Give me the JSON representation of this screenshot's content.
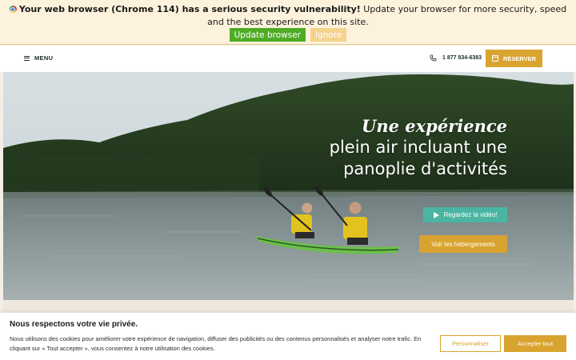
{
  "update_bar": {
    "bold_text": "Your web browser (Chrome 114) has a serious security vulnerability!",
    "text": " Update your browser for more security, speed and the best experience on this site.",
    "update_label": "Update browser",
    "ignore_label": "Ignore"
  },
  "header": {
    "menu_label": "MENU",
    "phone": "1 877 834-6383",
    "reserve_label": "RÉSERVER"
  },
  "hero": {
    "tagline_script": "Une expérience",
    "tagline_rest": "plein air incluant une panoplie d'activités",
    "video_label": "Regardez la vidéo!",
    "lodging_label": "Voir les hébergements"
  },
  "cookie": {
    "title": "Nous respectons votre vie privée.",
    "text": "Nous utilisons des cookies pour améliorer votre expérience de navigation, diffuser des publicités ou des contenus personnalisés et analyser notre trafic. En cliquant sur « Tout accepter », vous consentez à notre utilisation des cookies.",
    "customize_label": "Personnaliser",
    "accept_label": "Accepter tout"
  },
  "colors": {
    "accent_gold": "#d9a32f",
    "teal": "#4ab5a2",
    "update_green": "#4eac24"
  }
}
